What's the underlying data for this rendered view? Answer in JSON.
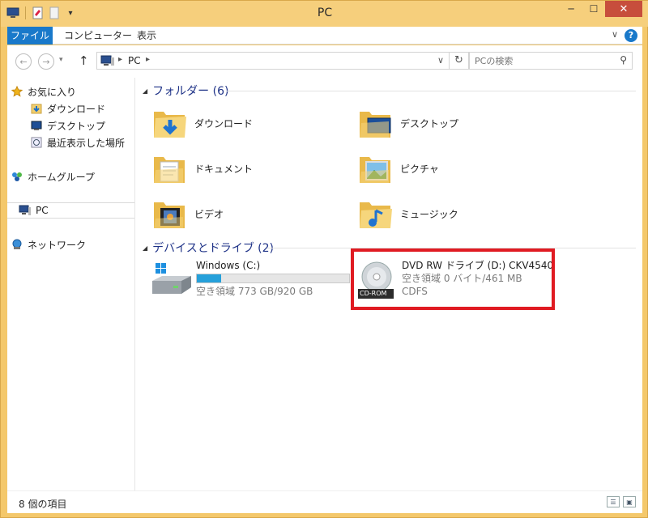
{
  "window": {
    "title": "PC"
  },
  "ribbon": {
    "tabs": [
      {
        "label": "ファイル"
      },
      {
        "label": "コンピューター"
      },
      {
        "label": "表示"
      }
    ],
    "help_label": "?"
  },
  "address": {
    "crumb": "PC",
    "search_placeholder": "PCの検索"
  },
  "nav": {
    "favorites": "お気に入り",
    "downloads": "ダウンロード",
    "desktop": "デスクトップ",
    "recent": "最近表示した場所",
    "homegroup": "ホームグループ",
    "pc": "PC",
    "network": "ネットワーク"
  },
  "folders": {
    "header": "フォルダー (6)",
    "items": [
      {
        "label": "ダウンロード",
        "icon": "downloads-folder-icon"
      },
      {
        "label": "デスクトップ",
        "icon": "desktop-folder-icon"
      },
      {
        "label": "ドキュメント",
        "icon": "documents-folder-icon"
      },
      {
        "label": "ピクチャ",
        "icon": "pictures-folder-icon"
      },
      {
        "label": "ビデオ",
        "icon": "videos-folder-icon"
      },
      {
        "label": "ミュージック",
        "icon": "music-folder-icon"
      }
    ]
  },
  "devices": {
    "header": "デバイスとドライブ (2)",
    "windows_drive": {
      "name": "Windows (C:)",
      "free": "空き領域 773 GB/920 GB",
      "used_fraction": 0.16
    },
    "dvd_drive": {
      "name": "DVD RW ドライブ (D:) CKV4540",
      "free": "空き領域 0 バイト/461 MB",
      "fs": "CDFS",
      "icon_text": "CD-ROM"
    }
  },
  "status": {
    "count": "8 個の項目"
  },
  "colors": {
    "accent": "#1979ca",
    "frame": "#f4c86b",
    "close": "#c74e3c",
    "highlight": "#e01b22",
    "bar_fill": "#26a0da"
  }
}
